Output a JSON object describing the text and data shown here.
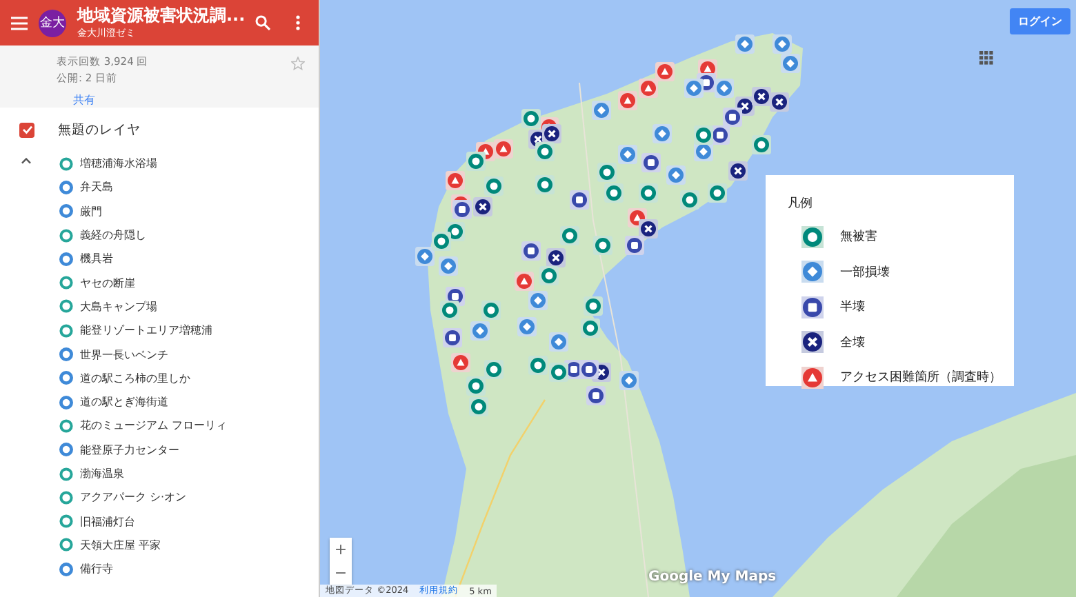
{
  "header": {
    "title": "地域資源被害状況調...",
    "subtitle": "金大川澄ゼミ",
    "avatar": "金大"
  },
  "info": {
    "views": "表示回数 3,924 回",
    "published": "公開: 2 日前",
    "share": "共有",
    "starred": false
  },
  "layer": {
    "name": "無題のレイヤ",
    "checked": true,
    "expanded": true,
    "items": [
      {
        "label": "増穂浦海水浴場",
        "kind": "none"
      },
      {
        "label": "弁天島",
        "kind": "partial"
      },
      {
        "label": "厳門",
        "kind": "partial"
      },
      {
        "label": "義経の舟隠し",
        "kind": "none"
      },
      {
        "label": "機具岩",
        "kind": "partial"
      },
      {
        "label": "ヤセの断崖",
        "kind": "none"
      },
      {
        "label": "大島キャンプ場",
        "kind": "none"
      },
      {
        "label": "能登リゾートエリア増穂浦",
        "kind": "none"
      },
      {
        "label": "世界一長いベンチ",
        "kind": "partial"
      },
      {
        "label": "道の駅ころ柿の里しか",
        "kind": "partial"
      },
      {
        "label": "道の駅とぎ海街道",
        "kind": "partial"
      },
      {
        "label": "花のミュージアム フローリィ",
        "kind": "none"
      },
      {
        "label": "能登原子力センター",
        "kind": "partial"
      },
      {
        "label": "渤海温泉",
        "kind": "none"
      },
      {
        "label": "アクアパーク シ·オン",
        "kind": "none"
      },
      {
        "label": "旧福浦灯台",
        "kind": "none"
      },
      {
        "label": "天領大庄屋 平家",
        "kind": "none"
      },
      {
        "label": "備行寺",
        "kind": "partial"
      }
    ]
  },
  "map": {
    "login": "ログイン",
    "attribution": "地図データ ©2024",
    "terms": "利用規約",
    "scale": "5 km",
    "zoom_in": "+",
    "zoom_out": "−",
    "logo": "Google My Maps"
  },
  "legend": {
    "title": "凡例",
    "items": [
      {
        "label": "無被害",
        "kind": "none"
      },
      {
        "label": "一部損壊",
        "kind": "partial"
      },
      {
        "label": "半壊",
        "kind": "half"
      },
      {
        "label": "全壊",
        "kind": "total"
      },
      {
        "label": "アクセス困難箇所（調査時）",
        "kind": "access"
      }
    ]
  }
}
